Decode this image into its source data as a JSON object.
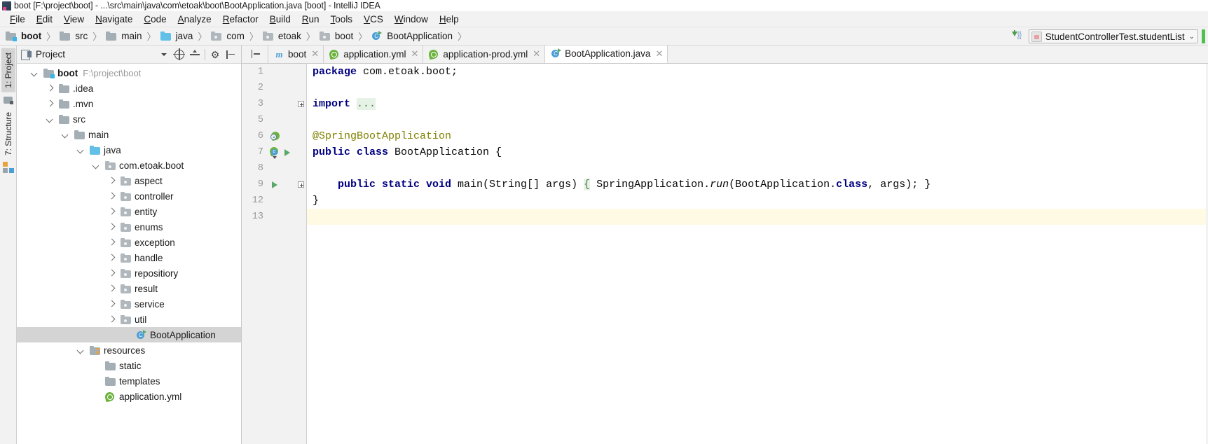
{
  "window": {
    "title": "boot [F:\\project\\boot] - ...\\src\\main\\java\\com\\etoak\\boot\\BootApplication.java [boot] - IntelliJ IDEA"
  },
  "menubar": {
    "items": [
      "File",
      "Edit",
      "View",
      "Navigate",
      "Code",
      "Analyze",
      "Refactor",
      "Build",
      "Run",
      "Tools",
      "VCS",
      "Window",
      "Help"
    ]
  },
  "breadcrumb": {
    "items": [
      {
        "label": "boot",
        "icon": "module-folder-icon"
      },
      {
        "label": "src",
        "icon": "folder-icon"
      },
      {
        "label": "main",
        "icon": "folder-icon"
      },
      {
        "label": "java",
        "icon": "source-folder-icon"
      },
      {
        "label": "com",
        "icon": "package-icon"
      },
      {
        "label": "etoak",
        "icon": "package-icon"
      },
      {
        "label": "boot",
        "icon": "package-icon"
      },
      {
        "label": "BootApplication",
        "icon": "spring-class-icon"
      }
    ],
    "separator": "〉"
  },
  "toolbar_right": {
    "download_icon": "binary-download-icon",
    "run_config": "StudentControllerTest.studentList",
    "chevron": "⌄"
  },
  "rail": {
    "project_button": "1: Project",
    "structure_button": "7: Structure"
  },
  "project_panel": {
    "title": "Project",
    "buttons": [
      "scope-chevron-icon",
      "locate-icon",
      "collapse-all-icon",
      "settings-gear-icon",
      "hide-icon"
    ],
    "tree": [
      {
        "label": "boot",
        "path": "F:\\project\\boot",
        "depth": 0,
        "twisty": "down",
        "icon": "module-folder-icon",
        "bold": true,
        "selected": false
      },
      {
        "label": ".idea",
        "path": "",
        "depth": 1,
        "twisty": "right",
        "icon": "folder-icon",
        "bold": false,
        "selected": false
      },
      {
        "label": ".mvn",
        "path": "",
        "depth": 1,
        "twisty": "right",
        "icon": "folder-icon",
        "bold": false,
        "selected": false
      },
      {
        "label": "src",
        "path": "",
        "depth": 1,
        "twisty": "down",
        "icon": "folder-icon",
        "bold": false,
        "selected": false
      },
      {
        "label": "main",
        "path": "",
        "depth": 2,
        "twisty": "down",
        "icon": "folder-icon",
        "bold": false,
        "selected": false
      },
      {
        "label": "java",
        "path": "",
        "depth": 3,
        "twisty": "down",
        "icon": "source-folder-icon",
        "bold": false,
        "selected": false
      },
      {
        "label": "com.etoak.boot",
        "path": "",
        "depth": 4,
        "twisty": "down",
        "icon": "package-icon",
        "bold": false,
        "selected": false
      },
      {
        "label": "aspect",
        "path": "",
        "depth": 5,
        "twisty": "right",
        "icon": "package-icon",
        "bold": false,
        "selected": false
      },
      {
        "label": "controller",
        "path": "",
        "depth": 5,
        "twisty": "right",
        "icon": "package-icon",
        "bold": false,
        "selected": false
      },
      {
        "label": "entity",
        "path": "",
        "depth": 5,
        "twisty": "right",
        "icon": "package-icon",
        "bold": false,
        "selected": false
      },
      {
        "label": "enums",
        "path": "",
        "depth": 5,
        "twisty": "right",
        "icon": "package-icon",
        "bold": false,
        "selected": false
      },
      {
        "label": "exception",
        "path": "",
        "depth": 5,
        "twisty": "right",
        "icon": "package-icon",
        "bold": false,
        "selected": false
      },
      {
        "label": "handle",
        "path": "",
        "depth": 5,
        "twisty": "right",
        "icon": "package-icon",
        "bold": false,
        "selected": false
      },
      {
        "label": "repositiory",
        "path": "",
        "depth": 5,
        "twisty": "right",
        "icon": "package-icon",
        "bold": false,
        "selected": false
      },
      {
        "label": "result",
        "path": "",
        "depth": 5,
        "twisty": "right",
        "icon": "package-icon",
        "bold": false,
        "selected": false
      },
      {
        "label": "service",
        "path": "",
        "depth": 5,
        "twisty": "right",
        "icon": "package-icon",
        "bold": false,
        "selected": false
      },
      {
        "label": "util",
        "path": "",
        "depth": 5,
        "twisty": "right",
        "icon": "package-icon",
        "bold": false,
        "selected": false
      },
      {
        "label": "BootApplication",
        "path": "",
        "depth": 6,
        "twisty": "none",
        "icon": "spring-class-icon",
        "bold": false,
        "selected": true
      },
      {
        "label": "resources",
        "path": "",
        "depth": 3,
        "twisty": "down",
        "icon": "resources-folder-icon",
        "bold": false,
        "selected": false
      },
      {
        "label": "static",
        "path": "",
        "depth": 4,
        "twisty": "none",
        "icon": "folder-icon",
        "bold": false,
        "selected": false
      },
      {
        "label": "templates",
        "path": "",
        "depth": 4,
        "twisty": "none",
        "icon": "folder-icon",
        "bold": false,
        "selected": false
      },
      {
        "label": "application.yml",
        "path": "",
        "depth": 4,
        "twisty": "none",
        "icon": "spring-yml-icon",
        "bold": false,
        "selected": false
      }
    ]
  },
  "editor": {
    "tabs": [
      {
        "label": "boot",
        "icon": "maven-icon",
        "active": false,
        "closable": true
      },
      {
        "label": "application.yml",
        "icon": "spring-yml-icon",
        "active": false,
        "closable": true
      },
      {
        "label": "application-prod.yml",
        "icon": "spring-yml-icon",
        "active": false,
        "closable": true
      },
      {
        "label": "BootApplication.java",
        "icon": "spring-class-icon",
        "active": true,
        "closable": true
      }
    ],
    "lines": [
      {
        "num": "1",
        "markers": [],
        "fold": "none",
        "caret": false,
        "tokens": [
          {
            "t": "package",
            "c": "kw"
          },
          {
            "t": " com.etoak.boot;",
            "c": "plain"
          }
        ]
      },
      {
        "num": "2",
        "markers": [],
        "fold": "none",
        "caret": false,
        "tokens": []
      },
      {
        "num": "3",
        "markers": [],
        "fold": "plus",
        "caret": false,
        "tokens": [
          {
            "t": "import",
            "c": "kw"
          },
          {
            "t": " ",
            "c": "plain"
          },
          {
            "t": "...",
            "c": "fold"
          }
        ]
      },
      {
        "num": "5",
        "markers": [],
        "fold": "none",
        "caret": false,
        "tokens": []
      },
      {
        "num": "6",
        "markers": [
          "spring-bean-icon"
        ],
        "fold": "none",
        "caret": false,
        "tokens": [
          {
            "t": "@SpringBootApplication",
            "c": "ann"
          }
        ]
      },
      {
        "num": "7",
        "markers": [
          "spring-class-gutter-icon",
          "run-icon"
        ],
        "fold": "none",
        "caret": false,
        "tokens": [
          {
            "t": "public class",
            "c": "kw"
          },
          {
            "t": " BootApplication {",
            "c": "plain"
          }
        ]
      },
      {
        "num": "8",
        "markers": [],
        "fold": "none",
        "caret": false,
        "tokens": []
      },
      {
        "num": "9",
        "markers": [
          "run-icon"
        ],
        "fold": "plus-right",
        "caret": false,
        "tokens": [
          {
            "t": "    public static void ",
            "c": "kw"
          },
          {
            "t": "main(String[] args) ",
            "c": "plain"
          },
          {
            "t": "{",
            "c": "fold"
          },
          {
            "t": " SpringApplication.",
            "c": "plain"
          },
          {
            "t": "run",
            "c": "ital"
          },
          {
            "t": "(BootApplication.",
            "c": "plain"
          },
          {
            "t": "class",
            "c": "kw"
          },
          {
            "t": ", args); ",
            "c": "plain"
          },
          {
            "t": "}",
            "c": "plain"
          }
        ]
      },
      {
        "num": "12",
        "markers": [],
        "fold": "none",
        "caret": false,
        "tokens": [
          {
            "t": "}",
            "c": "plain"
          }
        ]
      },
      {
        "num": "13",
        "markers": [],
        "fold": "none",
        "caret": true,
        "tokens": []
      }
    ]
  }
}
